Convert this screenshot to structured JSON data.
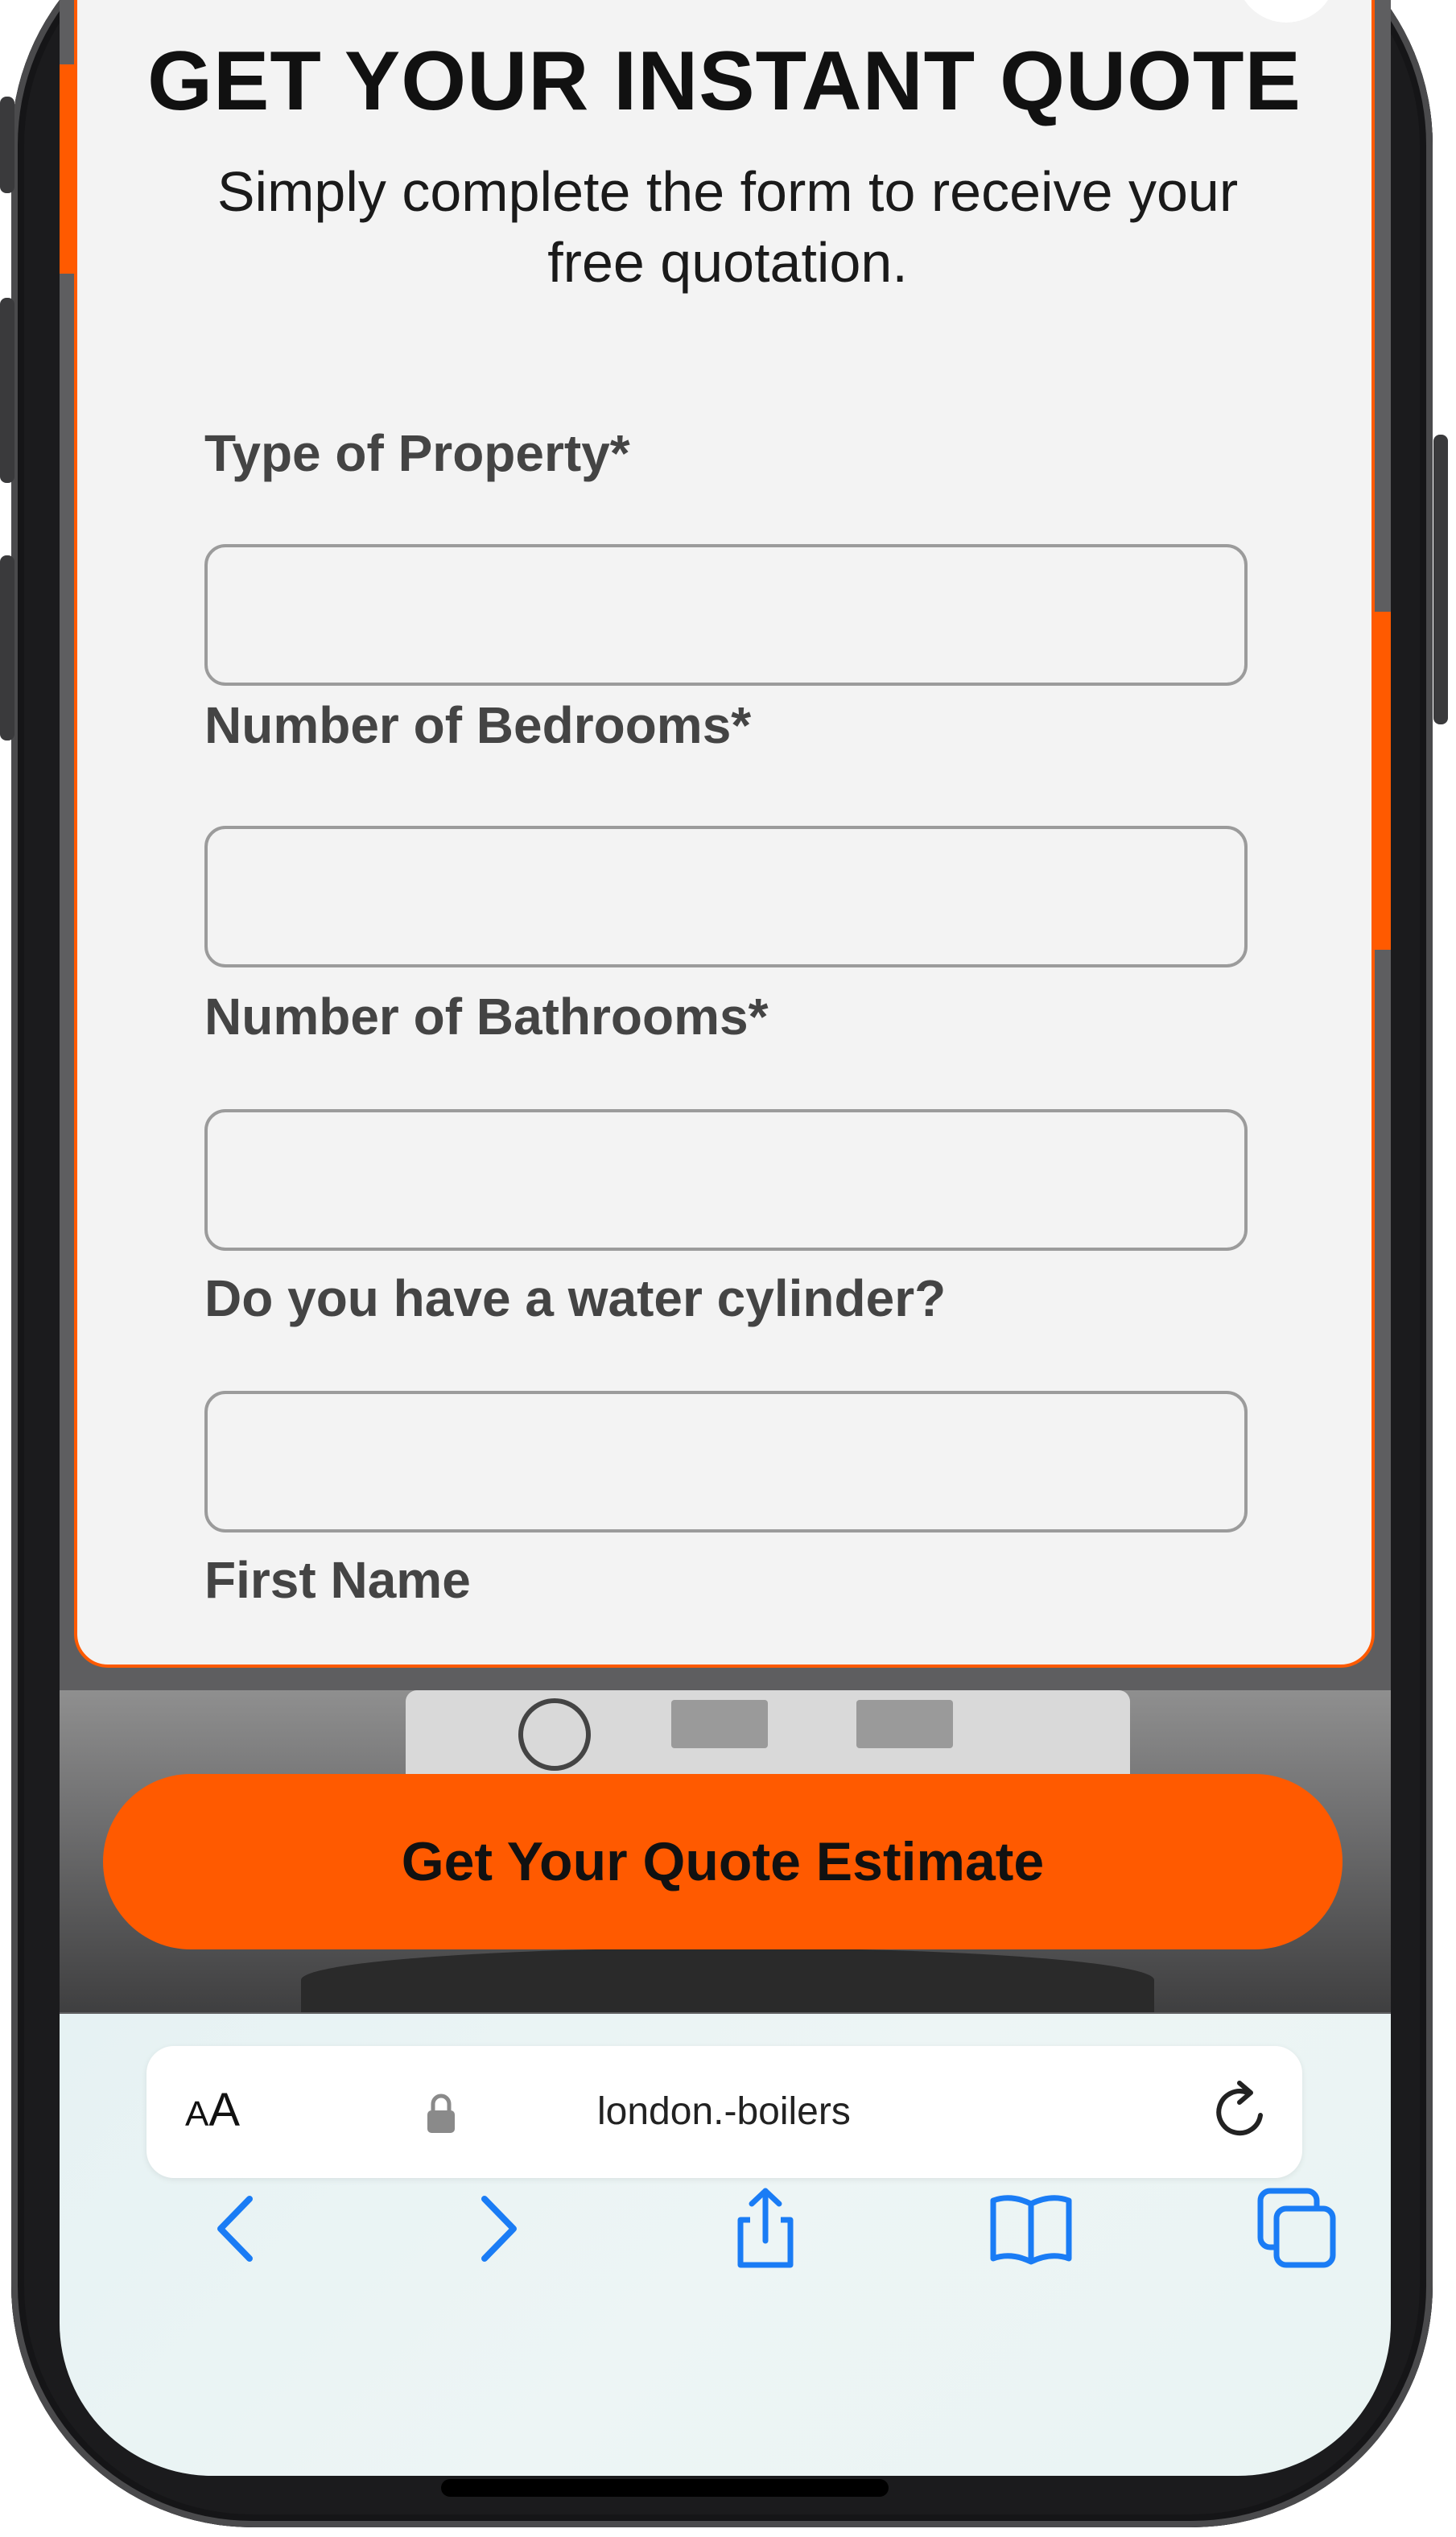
{
  "modal": {
    "title": "GET YOUR INSTANT QUOTE",
    "subtitle": "Simply complete the form to receive your free quotation.",
    "close_icon": "close-icon",
    "fields": [
      {
        "label": "Type of Property*",
        "value": ""
      },
      {
        "label": "Number of Bedrooms*",
        "value": ""
      },
      {
        "label": "Number of Bathrooms*",
        "value": ""
      },
      {
        "label": "Do you have a water cylinder?",
        "value": ""
      },
      {
        "label": "First Name",
        "value": ""
      }
    ]
  },
  "cta": {
    "label": "Get Your Quote Estimate"
  },
  "browser": {
    "text_size_label_small": "A",
    "text_size_label_large": "A",
    "url": "london.-boilers",
    "icons": [
      "lock-icon",
      "reload-icon",
      "back-icon",
      "forward-icon",
      "share-icon",
      "bookmarks-icon",
      "tabs-icon"
    ]
  },
  "colors": {
    "accent": "#ff5a00",
    "safari_blue": "#1a7cf5"
  }
}
